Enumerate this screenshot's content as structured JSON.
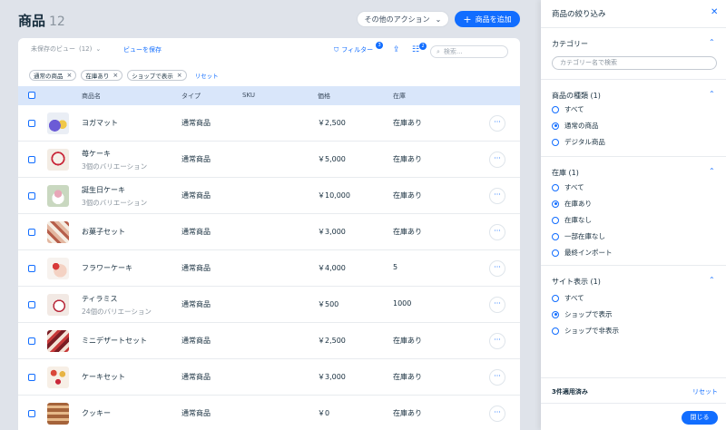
{
  "header": {
    "title": "商品",
    "count": "12",
    "more_actions": "その他のアクション",
    "add_product": "商品を追加"
  },
  "toolbar": {
    "unsaved_view": "未保存のビュー",
    "view_count": "(12)",
    "save_view": "ビューを保存",
    "filter_label": "フィルター",
    "filter_badge": "3",
    "columns_badge": "2",
    "search_placeholder": "検索..."
  },
  "chips": [
    "通常の商品",
    "在庫あり",
    "ショップで表示"
  ],
  "chips_reset": "リセット",
  "table": {
    "columns": {
      "name": "商品名",
      "type": "タイプ",
      "sku": "SKU",
      "price": "価格",
      "stock": "在庫"
    },
    "rows": [
      {
        "name": "ヨガマット",
        "sub": "",
        "type": "通常商品",
        "price": "￥2,500",
        "stock": "在庫あり"
      },
      {
        "name": "苺ケーキ",
        "sub": "3個のバリエーション",
        "type": "通常商品",
        "price": "￥5,000",
        "stock": "在庫あり"
      },
      {
        "name": "誕生日ケーキ",
        "sub": "3個のバリエーション",
        "type": "通常商品",
        "price": "￥10,000",
        "stock": "在庫あり"
      },
      {
        "name": "お菓子セット",
        "sub": "",
        "type": "通常商品",
        "price": "￥3,000",
        "stock": "在庫あり"
      },
      {
        "name": "フラワーケーキ",
        "sub": "",
        "type": "通常商品",
        "price": "￥4,000",
        "stock": "5"
      },
      {
        "name": "ティラミス",
        "sub": "24個のバリエーション",
        "type": "通常商品",
        "price": "￥500",
        "stock": "1000"
      },
      {
        "name": "ミニデザートセット",
        "sub": "",
        "type": "通常商品",
        "price": "￥2,500",
        "stock": "在庫あり"
      },
      {
        "name": "ケーキセット",
        "sub": "",
        "type": "通常商品",
        "price": "￥3,000",
        "stock": "在庫あり"
      },
      {
        "name": "クッキー",
        "sub": "",
        "type": "通常商品",
        "price": "￥0",
        "stock": "在庫あり"
      }
    ]
  },
  "panel": {
    "title": "商品の絞り込み",
    "category": {
      "title": "カテゴリー",
      "placeholder": "カテゴリー名で検索"
    },
    "product_type": {
      "title": "商品の種類 (1)",
      "options": [
        "すべて",
        "通常の商品",
        "デジタル商品"
      ],
      "selected": 1
    },
    "stock": {
      "title": "在庫 (1)",
      "options": [
        "すべて",
        "在庫あり",
        "在庫なし",
        "一部在庫なし",
        "最終インポート"
      ],
      "selected": 1
    },
    "site_display": {
      "title": "サイト表示 (1)",
      "options": [
        "すべて",
        "ショップで表示",
        "ショップで非表示"
      ],
      "selected": 1
    },
    "footer": {
      "applied": "3件適用済み",
      "reset": "リセット",
      "close": "閉じる"
    }
  },
  "colors": {
    "accent": "#116dff",
    "header_row": "#d9e6fa",
    "background": "#dfe3ea"
  }
}
